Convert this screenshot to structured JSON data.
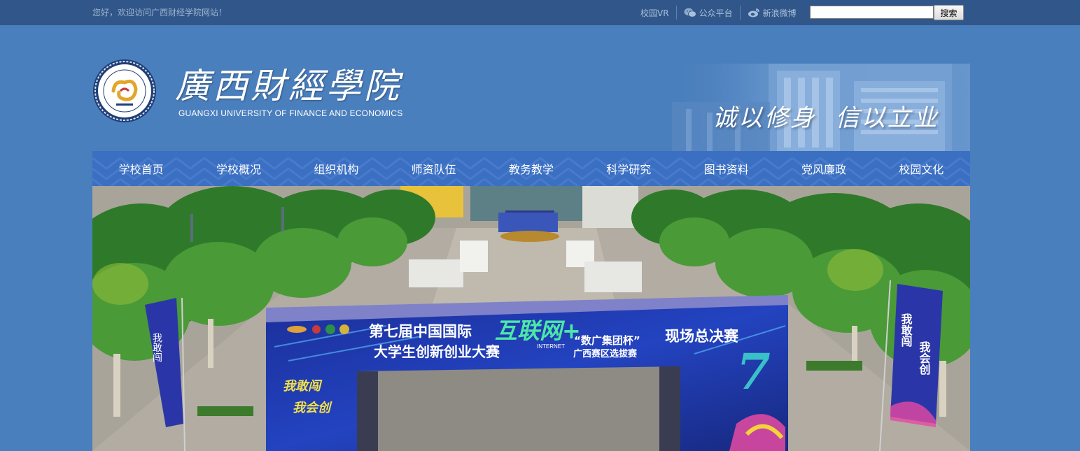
{
  "topbar": {
    "welcome": "您好，欢迎访问广西财经学院网站！",
    "links": [
      {
        "label": "校园VR",
        "icon": ""
      },
      {
        "label": "公众平台",
        "icon": "wechat-icon"
      },
      {
        "label": "新浪微博",
        "icon": "weibo-icon"
      }
    ],
    "search_button": "搜索",
    "search_value": ""
  },
  "header": {
    "school_name": "廣西財經學院",
    "school_name_en": "GUANGXI  UNIVERSITY OF FINANCE AND ECONOMICS",
    "motto": "诚以修身  信以立业"
  },
  "nav": {
    "items": [
      "学校首页",
      "学校概况",
      "组织机构",
      "师资队伍",
      "教务教学",
      "科学研究",
      "图书资料",
      "党风廉政",
      "校园文化"
    ]
  },
  "hero": {
    "arch_line1": "第七届中国国际",
    "arch_brand": "互联网+",
    "arch_brand_sub": "INTERNET",
    "arch_line2": "大学生创新创业大赛",
    "arch_cup": "“数广集团杯”",
    "arch_final": "现场总决赛",
    "arch_region": "广西赛区选拔赛",
    "slogan_1": "我敢闯",
    "slogan_2": "我会创",
    "flag_left": "我敢闯",
    "flag_right_1": "我敢闯",
    "flag_right_2": "我会创"
  },
  "colors": {
    "background": "#4a7fbd",
    "topbar": "#31578a",
    "nav": "#3b6fc2"
  }
}
